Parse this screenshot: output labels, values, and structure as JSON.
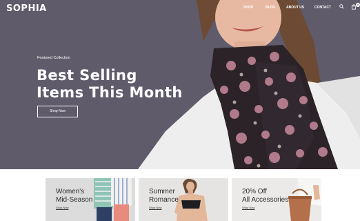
{
  "brand": {
    "logo": "SOPHIA"
  },
  "nav": {
    "items": [
      {
        "label": "SHOP"
      },
      {
        "label": "BLOG"
      },
      {
        "label": "ABOUT US"
      },
      {
        "label": "CONTACT"
      }
    ],
    "search_icon": "search-icon",
    "cart_icon": "cart-icon",
    "cart_count": "0"
  },
  "hero": {
    "eyebrow": "Featured Collection",
    "headline_line1": "Best Selling",
    "headline_line2": "Items This Month",
    "cta": "Shop Now",
    "background": "#5f5b6b"
  },
  "collections": [
    {
      "title_line1": "Women's",
      "title_line2": "Mid-Season",
      "link": "Shop Now",
      "bg": "#dcdcdc"
    },
    {
      "title_line1": "Summer",
      "title_line2": "Romance",
      "link": "Shop Now",
      "bg": "#e6e4e2"
    },
    {
      "title_line1": "20% Off",
      "title_line2": "All Accessories",
      "link": "Shop Now",
      "bg": "#ebeae8"
    }
  ]
}
